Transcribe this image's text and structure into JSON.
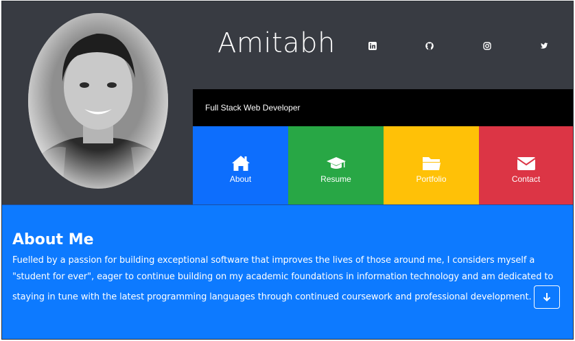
{
  "header": {
    "name": "Amitabh",
    "tagline": "Full Stack Web Developer",
    "social_icons": [
      "linkedin-icon",
      "github-icon",
      "instagram-icon",
      "twitter-icon"
    ]
  },
  "nav_tiles": [
    {
      "label": "About",
      "icon": "home-icon",
      "color": "#0d6efd"
    },
    {
      "label": "Resume",
      "icon": "graduation-cap-icon",
      "color": "#28a745"
    },
    {
      "label": "Portfolio",
      "icon": "folder-icon",
      "color": "#ffc107"
    },
    {
      "label": "Contact",
      "icon": "envelope-icon",
      "color": "#dc3545"
    }
  ],
  "about": {
    "title": "About Me",
    "body": "Fuelled by a passion for building exceptional software that improves the lives of those around me, I considers myself a \"student for ever\", eager to continue building on my academic foundations in information technology and am dedicated to staying in tune with the latest programming languages through continued coursework and professional development.",
    "scroll_icon": "arrow-down-icon"
  },
  "colors": {
    "header_bg": "#383b42",
    "tagline_bg": "#000000",
    "about_bg": "#0d7aff"
  }
}
